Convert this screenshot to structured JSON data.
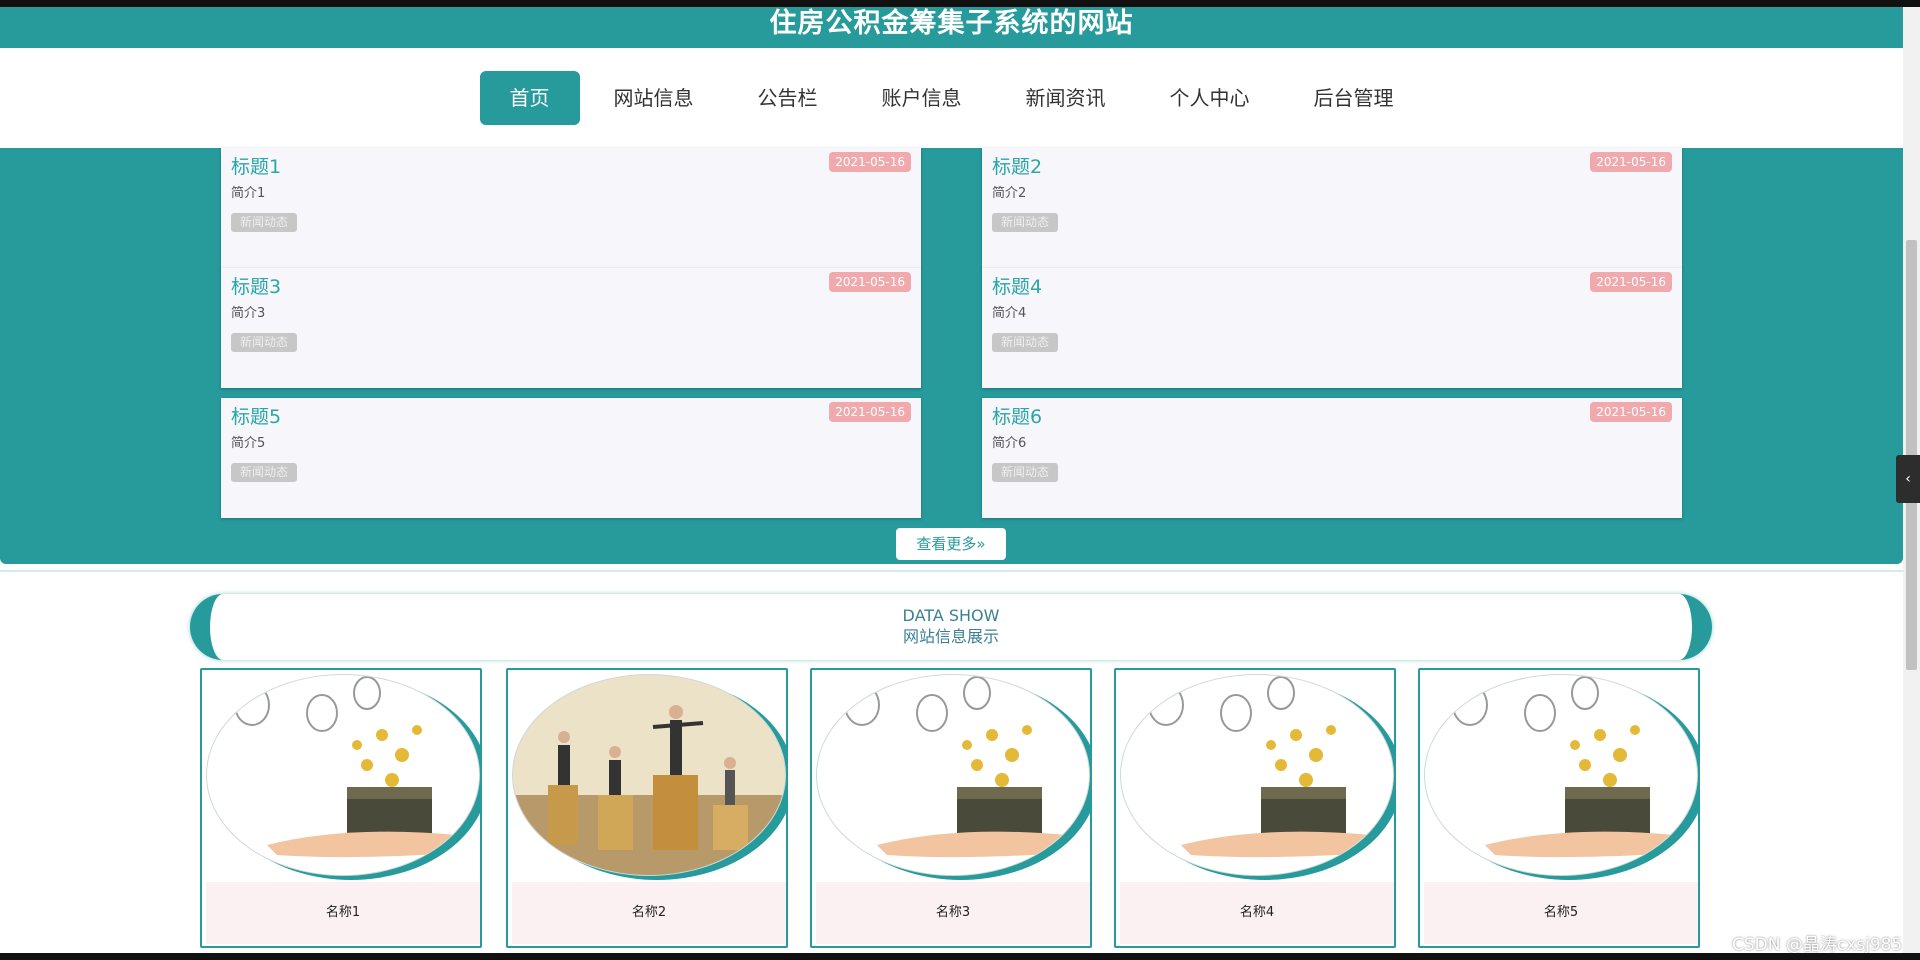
{
  "header": {
    "title": "住房公积金筹集子系统的网站"
  },
  "nav": {
    "items": [
      {
        "label": "首页",
        "active": true
      },
      {
        "label": "网站信息"
      },
      {
        "label": "公告栏"
      },
      {
        "label": "账户信息"
      },
      {
        "label": "新闻资讯"
      },
      {
        "label": "个人中心"
      },
      {
        "label": "后台管理"
      }
    ]
  },
  "news": {
    "items": [
      {
        "title": "标题1",
        "date": "2021-05-16",
        "summary": "简介1",
        "tag": "新闻动态"
      },
      {
        "title": "标题2",
        "date": "2021-05-16",
        "summary": "简介2",
        "tag": "新闻动态"
      },
      {
        "title": "标题3",
        "date": "2021-05-16",
        "summary": "简介3",
        "tag": "新闻动态"
      },
      {
        "title": "标题4",
        "date": "2021-05-16",
        "summary": "简介4",
        "tag": "新闻动态"
      },
      {
        "title": "标题5",
        "date": "2021-05-16",
        "summary": "简介5",
        "tag": "新闻动态"
      },
      {
        "title": "标题6",
        "date": "2021-05-16",
        "summary": "简介6",
        "tag": "新闻动态"
      }
    ],
    "more_label": "查看更多»"
  },
  "data_show": {
    "title_en": "DATA SHOW",
    "title_cn": "网站信息展示",
    "items": [
      {
        "name": "名称1",
        "image": "treasure-chest-hand"
      },
      {
        "name": "名称2",
        "image": "business-people-coins"
      },
      {
        "name": "名称3",
        "image": "treasure-chest-hand"
      },
      {
        "name": "名称4",
        "image": "treasure-chest-hand"
      },
      {
        "name": "名称5",
        "image": "treasure-chest-hand"
      }
    ]
  },
  "watermark": "CSDN @晶涛cxsj985",
  "colors": {
    "primary": "#279a9c",
    "date_badge": "#f0a9ad",
    "title_text": "#2aa6a8"
  },
  "icons": {
    "side_toggle": "chevron-left-icon"
  },
  "side_toggle_glyph": "‹"
}
